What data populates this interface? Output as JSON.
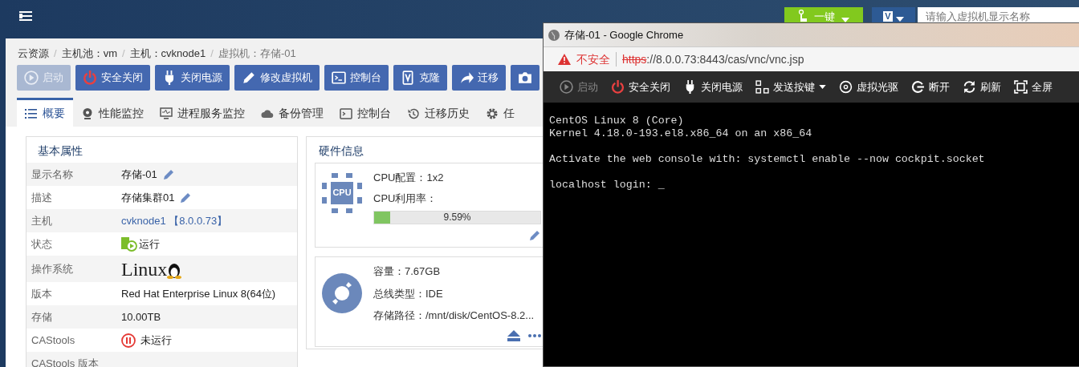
{
  "topbar": {
    "quick_button": "一键",
    "view_button": "V",
    "search": {
      "placeholder": "请输入虚拟机显示名称"
    }
  },
  "breadcrumb_separator": "/",
  "breadcrumb": [
    {
      "label": "云资源",
      "link": true
    },
    {
      "label": "主机池：vm",
      "link": true
    },
    {
      "label": "主机：cvknode1",
      "link": true
    },
    {
      "label": "虚拟机：存储-01",
      "link": false
    }
  ],
  "toolbar": [
    {
      "label": "启动",
      "disabled": true
    },
    {
      "label": "安全关闭",
      "disabled": false
    },
    {
      "label": "关闭电源",
      "disabled": false
    },
    {
      "label": "修改虚拟机",
      "disabled": false
    },
    {
      "label": "控制台",
      "disabled": false
    },
    {
      "label": "克隆",
      "disabled": false
    },
    {
      "label": "迁移",
      "disabled": false
    },
    {
      "disabled": false
    }
  ],
  "tabs": [
    {
      "label": "概要",
      "selected": true
    },
    {
      "label": "性能监控",
      "selected": false
    },
    {
      "label": "进程服务监控",
      "selected": false
    },
    {
      "label": "备份管理",
      "selected": false
    },
    {
      "label": "控制台",
      "selected": false
    },
    {
      "label": "迁移历史",
      "selected": false
    },
    {
      "label": "任",
      "selected": false
    }
  ],
  "basic_properties": {
    "title": "基本属性",
    "rows": [
      {
        "label": "显示名称",
        "kind": "editable",
        "value": "存储-01"
      },
      {
        "label": "描述",
        "kind": "editable",
        "value": "存储集群01"
      },
      {
        "label": "主机",
        "kind": "link",
        "value": "cvknode1 【8.0.0.73】"
      },
      {
        "label": "状态",
        "kind": "running",
        "value": "运行"
      },
      {
        "label": "操作系统",
        "kind": "logo",
        "value": "Linux"
      },
      {
        "label": "版本",
        "kind": "text",
        "value": "Red Hat Enterprise Linux 8(64位)"
      },
      {
        "label": "存储",
        "kind": "text",
        "value": "10.00TB"
      },
      {
        "label": "CAStools",
        "kind": "stopped",
        "value": "未运行"
      },
      {
        "label": "CAStools 版本",
        "kind": "text"
      }
    ]
  },
  "hardware": {
    "title": "硬件信息",
    "cpu": {
      "icon_label": "CPU",
      "config": "CPU配置：1x2",
      "usage_label": "CPU利用率：",
      "level": 0.0959,
      "reading": "9.59%"
    },
    "disk": {
      "capacity": "容量：7.67GB",
      "bus": "总线类型：IDE",
      "path": "存储路径：/mnt/disk/CentOS-8.2..."
    }
  },
  "console_window": {
    "title": "存储-01 - Google Chrome",
    "security": "不安全",
    "url_scheme": "https",
    "url_rest": "://8.0.0.73:8443/cas/vnc/vnc.jsp",
    "toolbar": [
      {
        "label": "启动",
        "disabled": true
      },
      {
        "label": "安全关闭",
        "disabled": false
      },
      {
        "label": "关闭电源",
        "disabled": false
      },
      {
        "label": "发送按键",
        "disabled": false
      },
      {
        "label": "虚拟光驱",
        "disabled": false
      },
      {
        "label": "断开",
        "disabled": false
      },
      {
        "label": "刷新",
        "disabled": false
      },
      {
        "label": "全屏",
        "disabled": false
      }
    ],
    "terminal_paragraphs": [
      [
        "CentOS Linux 8 (Core)",
        "Kernel 4.18.0-193.el8.x86_64 on an x86_64"
      ],
      [
        "Activate the web console with: systemctl enable --now cockpit.socket"
      ],
      [
        "localhost login: _"
      ]
    ]
  }
}
